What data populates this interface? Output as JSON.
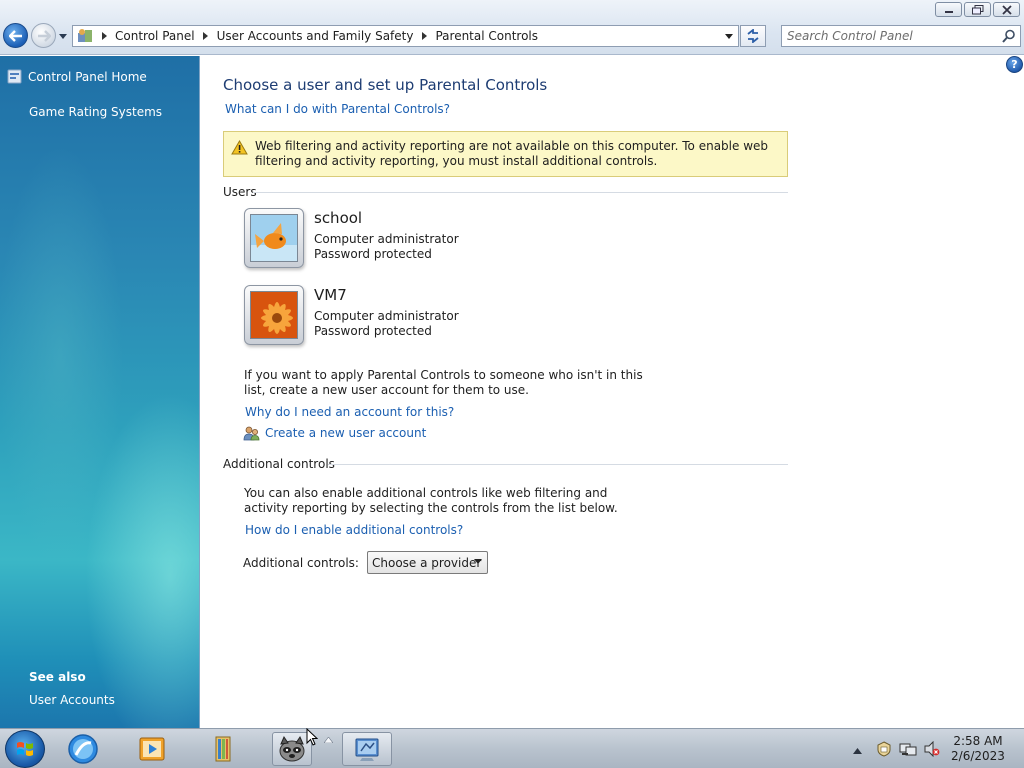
{
  "window": {
    "buttons": [
      "minimize",
      "maximize",
      "close"
    ]
  },
  "address_bar": {
    "breadcrumbs": [
      "Control Panel",
      "User Accounts and Family Safety",
      "Parental Controls"
    ]
  },
  "search": {
    "placeholder": "Search Control Panel"
  },
  "task_pane": {
    "home_label": "Control Panel Home",
    "links": [
      "Game Rating Systems"
    ],
    "see_also_heading": "See also",
    "see_also_links": [
      "User Accounts"
    ]
  },
  "main": {
    "title": "Choose a user and set up Parental Controls",
    "help_link": "What can I do with Parental Controls?",
    "warning_text": "Web filtering and activity reporting are not available on this computer. To enable web filtering and activity reporting, you must install additional controls.",
    "users_heading": "Users",
    "users": [
      {
        "name": "school",
        "role": "Computer administrator",
        "status": "Password protected",
        "picture": "goldfish"
      },
      {
        "name": "VM7",
        "role": "Computer administrator",
        "status": "Password protected",
        "picture": "orange-flower"
      }
    ],
    "no_user_text": "If you want to apply Parental Controls to someone who isn't in this list, create a new user account for them to use.",
    "why_account_link": "Why do I need an account for this?",
    "create_account_link": "Create a new user account",
    "additional_heading": "Additional controls",
    "additional_text": "You can also enable additional controls like web filtering and activity reporting by selecting the controls from the list below.",
    "how_enable_link": "How do I enable additional controls?",
    "additional_label": "Additional controls:",
    "provider_selected": "Choose a provider"
  },
  "taskbar": {
    "pinned": [
      "start-orb",
      "internet-explorer-icon",
      "media-player-icon",
      "file-explorer-icon",
      "raccoon-app-icon",
      "control-panel-icon"
    ],
    "time": "2:58 AM",
    "date": "2/6/2023"
  },
  "colors": {
    "link": "#1b5fb1",
    "title": "#1e3d73",
    "warning_bg": "#fcf8c7",
    "pane_top": "#1f6fa6",
    "pane_mid": "#3bb7c6"
  }
}
